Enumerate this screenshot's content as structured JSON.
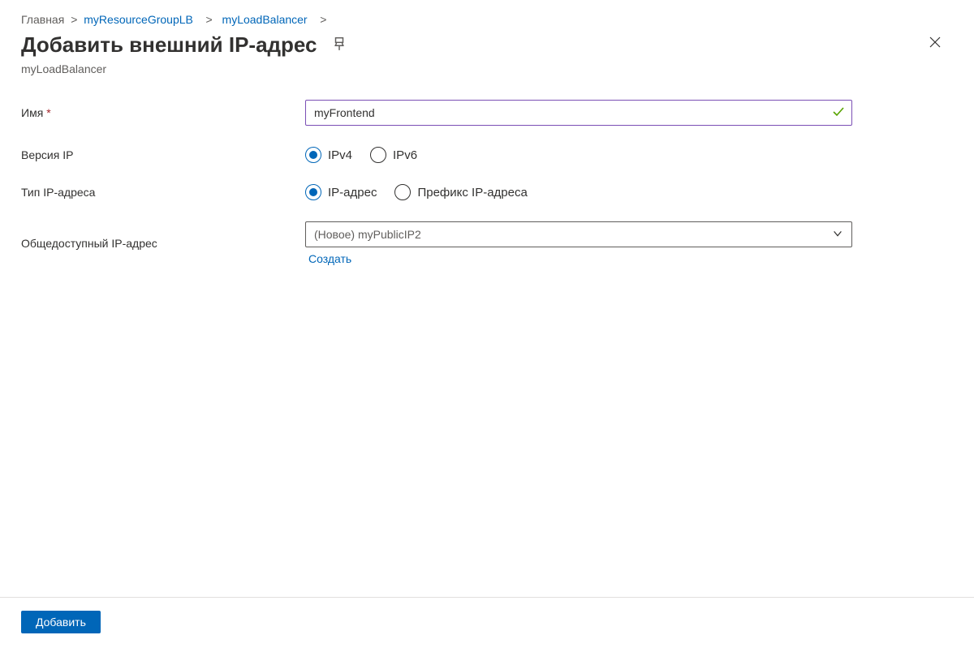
{
  "breadcrumb": {
    "home": "Главная",
    "group": "myResourceGroupLB",
    "resource": "myLoadBalancer"
  },
  "header": {
    "title": "Добавить внешний IP-адрес",
    "subtitle": "myLoadBalancer"
  },
  "form": {
    "name_label": "Имя",
    "name_value": "myFrontend",
    "ip_version_label": "Версия IP",
    "ip_version_options": {
      "v4": "IPv4",
      "v6": "IPv6"
    },
    "ip_type_label": "Тип IP-адреса",
    "ip_type_options": {
      "address": "IP-адрес",
      "prefix": "Префикс IP-адреса"
    },
    "public_ip_label": "Общедоступный IP-адрес",
    "public_ip_value": "(Новое) myPublicIP2",
    "create_link": "Создать"
  },
  "footer": {
    "add_button": "Добавить"
  }
}
